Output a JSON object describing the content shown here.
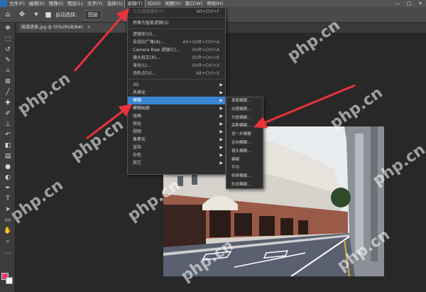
{
  "menubar": {
    "items": [
      "文件(F)",
      "编辑(E)",
      "图像(I)",
      "图层(L)",
      "文字(Y)",
      "选择(S)",
      "滤镜(T)",
      "3D(D)",
      "视图(V)",
      "窗口(W)",
      "帮助(H)"
    ],
    "window_controls": [
      "—",
      "□",
      "✕"
    ]
  },
  "optbar": {
    "auto_select_label": "自动选择：",
    "target_value": "图层"
  },
  "document_tab": {
    "title": "園湯透景.jpg @ 50%(RGB/8#)",
    "close": "×"
  },
  "filter_menu": {
    "items": [
      {
        "label": "上次滤镜操作(F)",
        "shortcut": "Alt+Ctrl+F",
        "dim": true
      },
      {
        "sep": true
      },
      {
        "label": "转换为智能滤镜(S)",
        "shortcut": ""
      },
      {
        "sep": true
      },
      {
        "label": "滤镜库(G)...",
        "shortcut": ""
      },
      {
        "label": "自适应广角(A)...",
        "shortcut": "Alt+Shift+Ctrl+A"
      },
      {
        "label": "Camera Raw 滤镜(C)...",
        "shortcut": "Shift+Ctrl+A"
      },
      {
        "label": "镜头校正(R)...",
        "shortcut": "Shift+Ctrl+R"
      },
      {
        "label": "液化(L)...",
        "shortcut": "Shift+Ctrl+X"
      },
      {
        "label": "消失点(V)...",
        "shortcut": "Alt+Ctrl+V"
      },
      {
        "sep": true
      },
      {
        "label": "3D",
        "submenu": true
      },
      {
        "label": "风格化",
        "submenu": true
      },
      {
        "label": "模糊",
        "submenu": true,
        "active": true
      },
      {
        "label": "模糊画廊",
        "submenu": true
      },
      {
        "label": "扭曲",
        "submenu": true
      },
      {
        "label": "锐化",
        "submenu": true
      },
      {
        "label": "视频",
        "submenu": true
      },
      {
        "label": "像素化",
        "submenu": true
      },
      {
        "label": "渲染",
        "submenu": true
      },
      {
        "label": "杂色",
        "submenu": true
      },
      {
        "label": "其它",
        "submenu": true
      }
    ]
  },
  "blur_submenu": {
    "items": [
      "表面模糊...",
      "动感模糊...",
      "方框模糊...",
      "高斯模糊...",
      "进一步模糊",
      "径向模糊...",
      "镜头模糊...",
      "模糊",
      "平均",
      "特殊模糊...",
      "形状模糊..."
    ]
  },
  "watermark": "php.cn",
  "colors": {
    "accent": "#3a86d4",
    "annotation_arrow": "#e8333a",
    "foreground_swatch": "#e0406a",
    "background_swatch": "#ffffff"
  },
  "tools": [
    "move-tool",
    "marquee-tool",
    "lasso-tool",
    "quick-select-tool",
    "crop-tool",
    "frame-tool",
    "eyedropper-tool",
    "healing-tool",
    "brush-tool",
    "clone-stamp-tool",
    "history-brush-tool",
    "eraser-tool",
    "gradient-tool",
    "blur-tool",
    "dodge-tool",
    "pen-tool",
    "type-tool",
    "path-select-tool",
    "rectangle-tool",
    "hand-tool",
    "zoom-tool",
    "more-tools"
  ]
}
